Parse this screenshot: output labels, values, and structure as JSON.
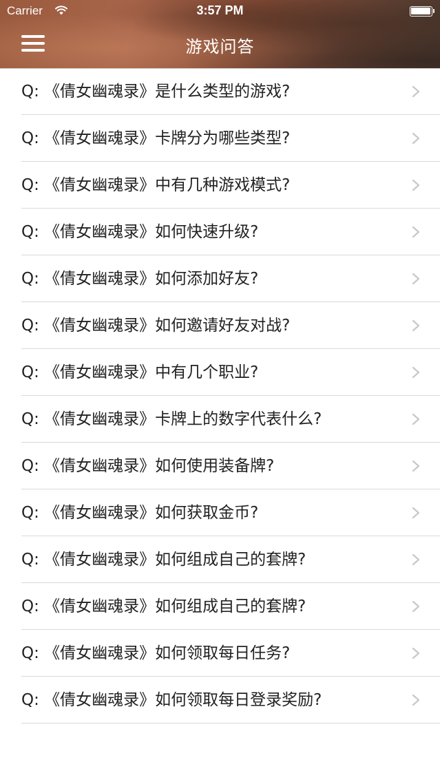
{
  "status_bar": {
    "carrier": "Carrier",
    "time": "3:57 PM",
    "wifi_icon": "wifi-icon",
    "battery_icon": "battery-icon",
    "battery_level": 1.0
  },
  "nav": {
    "title": "游戏问答",
    "menu_icon": "hamburger-menu-icon"
  },
  "colors": {
    "text": "#222222",
    "chevron": "#c7c7cc",
    "separator": "#d9d9dd",
    "header_tint": "#8a4f38"
  },
  "questions": [
    "Q: 《倩女幽魂录》是什么类型的游戏?",
    "Q: 《倩女幽魂录》卡牌分为哪些类型?",
    "Q: 《倩女幽魂录》中有几种游戏模式?",
    "Q: 《倩女幽魂录》如何快速升级?",
    "Q: 《倩女幽魂录》如何添加好友?",
    "Q: 《倩女幽魂录》如何邀请好友对战?",
    "Q: 《倩女幽魂录》中有几个职业?",
    "Q: 《倩女幽魂录》卡牌上的数字代表什么?",
    "Q: 《倩女幽魂录》如何使用装备牌?",
    "Q: 《倩女幽魂录》如何获取金币?",
    "Q: 《倩女幽魂录》如何组成自己的套牌?",
    "Q: 《倩女幽魂录》如何组成自己的套牌?",
    "Q: 《倩女幽魂录》如何领取每日任务?",
    "Q: 《倩女幽魂录》如何领取每日登录奖励?"
  ]
}
